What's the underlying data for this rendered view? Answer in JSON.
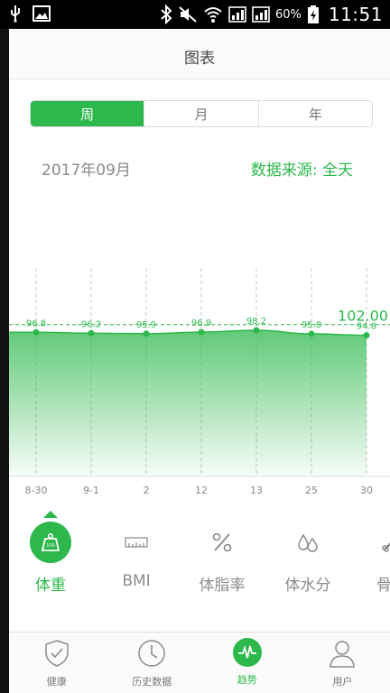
{
  "status_bar": {
    "battery_percent": "60%",
    "time": "11:51"
  },
  "header": {
    "title": "图表"
  },
  "period_tabs": [
    {
      "label": "周",
      "active": true
    },
    {
      "label": "月",
      "active": false
    },
    {
      "label": "年",
      "active": false
    }
  ],
  "date_label": "2017年09月",
  "data_source_label": "数据来源: 全天",
  "chart_data": {
    "type": "area",
    "categories": [
      "8-30",
      "9-1",
      "2",
      "12",
      "13",
      "25",
      "30"
    ],
    "values": [
      96.8,
      96.2,
      95.9,
      96.9,
      98.2,
      95.8,
      94.8
    ],
    "point_labels": [
      "96.8",
      "96.2",
      "95.9",
      "96.9",
      "98.2",
      "95.8",
      "94.8"
    ],
    "reference_line": {
      "value": 102.0,
      "label": "102.00"
    },
    "ylim": [
      0,
      140
    ],
    "grid": "vertical-dashed",
    "color": "#2cb84b"
  },
  "metrics": [
    {
      "label": "体重",
      "icon": "weight-icon",
      "active": true
    },
    {
      "label": "BMI",
      "icon": "ruler-icon",
      "active": false
    },
    {
      "label": "体脂率",
      "icon": "percent-icon",
      "active": false
    },
    {
      "label": "体水分",
      "icon": "water-drop-icon",
      "active": false
    },
    {
      "label": "骨骼",
      "icon": "bone-icon",
      "active": false
    }
  ],
  "tabs": [
    {
      "label": "健康",
      "icon": "shield-check-icon",
      "active": false
    },
    {
      "label": "历史数据",
      "icon": "clock-icon",
      "active": false
    },
    {
      "label": "趋势",
      "icon": "pulse-icon",
      "active": true
    },
    {
      "label": "用户",
      "icon": "user-icon",
      "active": false
    }
  ],
  "colors": {
    "accent": "#2cb84b"
  }
}
